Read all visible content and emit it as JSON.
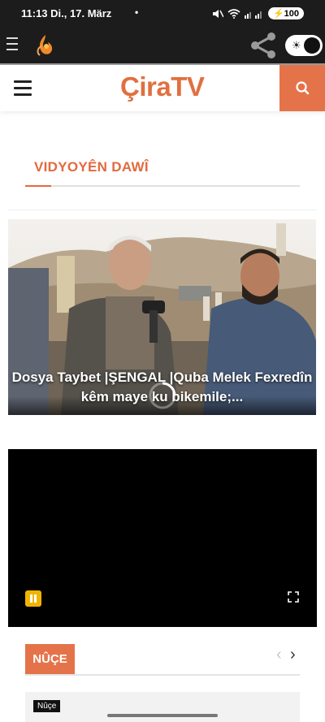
{
  "status_bar": {
    "time": "11:13",
    "date": "Di., 17. März",
    "dot": "•",
    "battery": "100"
  },
  "app_bar": {
    "menu_icon": "menu-icon",
    "logo_icon": "flame-logo-icon",
    "share_icon": "share-icon",
    "theme_toggle_icon": "sun-icon"
  },
  "header": {
    "brand": "ÇiraTV",
    "search_icon": "search-icon"
  },
  "videos_section": {
    "title": "VIDYOYÊN DAWÎ",
    "featured_caption": "Dosya Taybet |ŞENGAL |Quba Melek Fexredîn kêm maye ku bikemile;..."
  },
  "player": {
    "pause_icon": "pause-icon",
    "fullscreen_icon": "fullscreen-icon"
  },
  "news_section": {
    "tab_label": "NÛÇE",
    "prev_arrow": "‹",
    "next_arrow": "›",
    "badge": "Nûçe"
  },
  "colors": {
    "accent": "#e5734a",
    "dark_bar": "#1c1c1c",
    "player_bg": "#000000"
  }
}
